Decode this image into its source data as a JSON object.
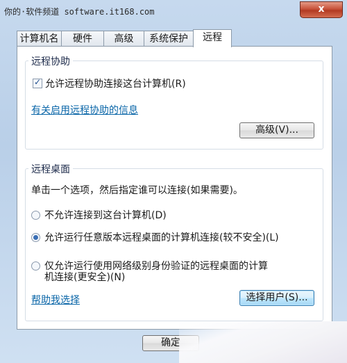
{
  "watermark": "你的·软件频道 software.it168.com",
  "title_bar": {
    "close_glyph": "x"
  },
  "tabs": [
    {
      "label": "计算机名"
    },
    {
      "label": "硬件"
    },
    {
      "label": "高级"
    },
    {
      "label": "系统保护"
    },
    {
      "label": "远程"
    }
  ],
  "remote_assistance": {
    "group_title": "远程协助",
    "checkbox_label": "允许远程协助连接这台计算机(R)",
    "checkbox_checked": true,
    "info_link": "有关启用远程协助的信息",
    "advanced_button": "高级(V)..."
  },
  "remote_desktop": {
    "group_title": "远程桌面",
    "instruction": "单击一个选项，然后指定谁可以连接(如果需要)。",
    "options": [
      {
        "label": "不允许连接到这台计算机(D)",
        "selected": false
      },
      {
        "label": "允许运行任意版本远程桌面的计算机连接(较不安全)(L)",
        "selected": true
      },
      {
        "label_line1": "仅允许运行使用网络级别身份验证的远程桌面的计算",
        "label_line2": "机连接(更安全)(N)",
        "selected": false
      }
    ],
    "help_link": "帮助我选择",
    "select_users_button": "选择用户(S)..."
  },
  "footer": {
    "ok_button": "确定"
  }
}
